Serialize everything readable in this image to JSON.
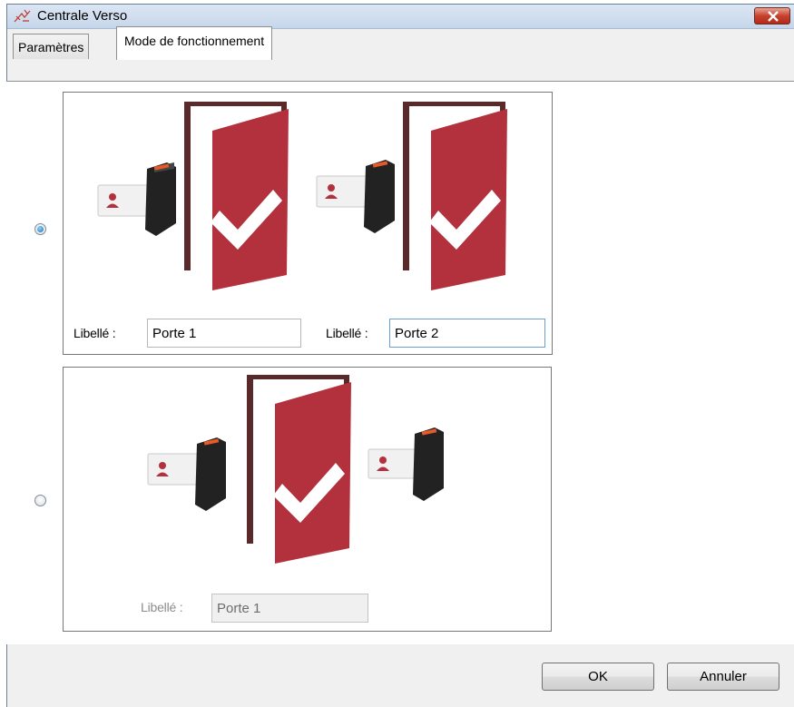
{
  "window": {
    "title": "Centrale Verso",
    "close_icon": "close-icon"
  },
  "tabs": [
    {
      "label": "Paramètres",
      "selected": false
    },
    {
      "label": "Mode de fonctionnement",
      "selected": true
    }
  ],
  "options": [
    {
      "selected": true,
      "doors": [
        {
          "label": "Libellé :",
          "value": "Porte 1"
        },
        {
          "label": "Libellé :",
          "value": "Porte 2"
        }
      ]
    },
    {
      "selected": false,
      "doors": [
        {
          "label": "Libellé :",
          "value": "Porte 1"
        }
      ]
    }
  ],
  "buttons": {
    "ok": "OK",
    "cancel": "Annuler"
  },
  "colors": {
    "door": "#b2313d",
    "frame": "#5a2a2a",
    "accent": "#1d6fb3"
  }
}
